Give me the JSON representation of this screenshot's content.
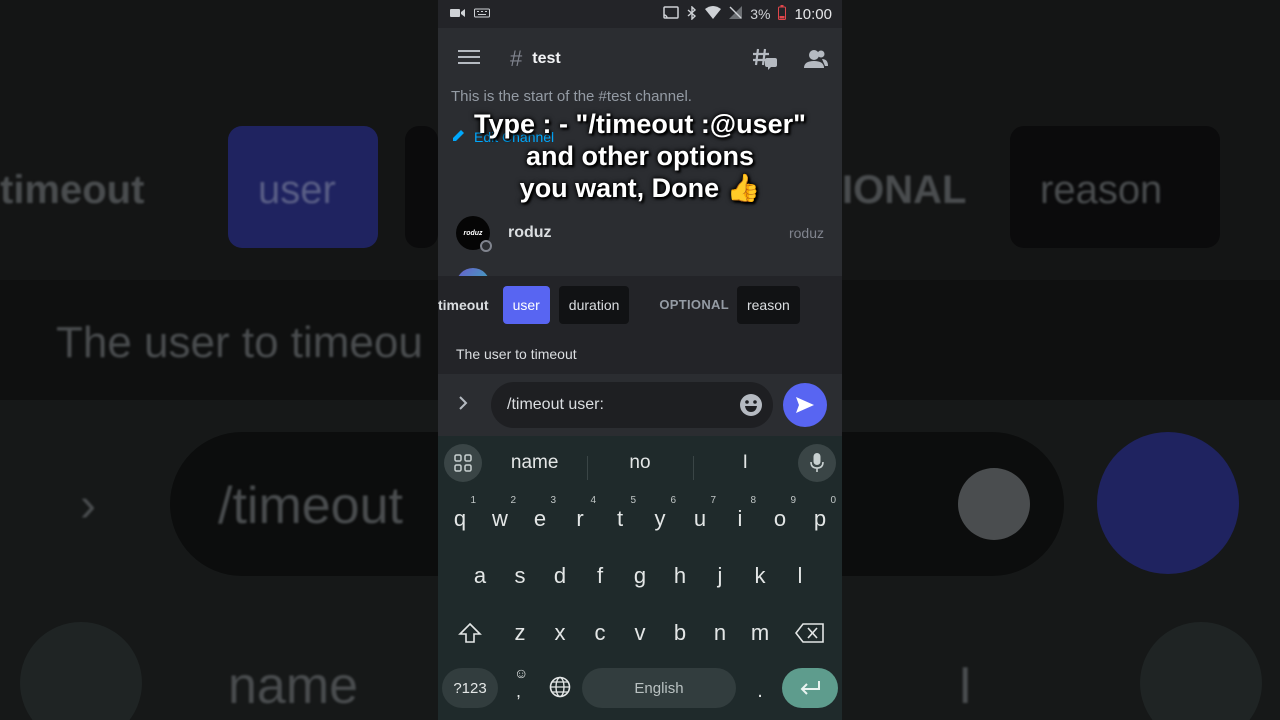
{
  "status_bar": {
    "battery": "3%",
    "time": "10:00"
  },
  "channel": {
    "hash": "#",
    "name": "test"
  },
  "chat": {
    "start_text": "This is the start of the #test channel.",
    "edit_link": "Edit Channel",
    "member": {
      "name": "roduz",
      "tag": "roduz",
      "avatar_text": "roduz"
    }
  },
  "command": {
    "name": "timeout",
    "params": [
      "user",
      "duration"
    ],
    "optional_label": "OPTIONAL",
    "optional_params": [
      "reason"
    ],
    "description": "The user to timeout"
  },
  "input": {
    "value": "/timeout user:"
  },
  "keyboard": {
    "suggestions": [
      "name",
      "no",
      "I"
    ],
    "row1": [
      "q",
      "w",
      "e",
      "r",
      "t",
      "y",
      "u",
      "i",
      "o",
      "p"
    ],
    "row1_nums": [
      "1",
      "2",
      "3",
      "4",
      "5",
      "6",
      "7",
      "8",
      "9",
      "0"
    ],
    "row2": [
      "a",
      "s",
      "d",
      "f",
      "g",
      "h",
      "j",
      "k",
      "l"
    ],
    "row3": [
      "z",
      "x",
      "c",
      "v",
      "b",
      "n",
      "m"
    ],
    "sym_label": "?123",
    "comma": ",",
    "space_label": "English",
    "period": "."
  },
  "caption": {
    "line1": "Type : - \"/timeout :@user\"",
    "line2": "and other options",
    "line3": "you want, Done 👍"
  },
  "background": {
    "timeout": "timeout",
    "user": "user",
    "optional": "IONAL",
    "reason": "reason",
    "desc": "The user to timeou",
    "input": "/timeout",
    "name": "name",
    "i": "I"
  },
  "colors": {
    "accent": "#5865f2",
    "panel": "#2b2d31",
    "keyboard": "#1f2a2b",
    "enter": "#5e9c8d"
  }
}
